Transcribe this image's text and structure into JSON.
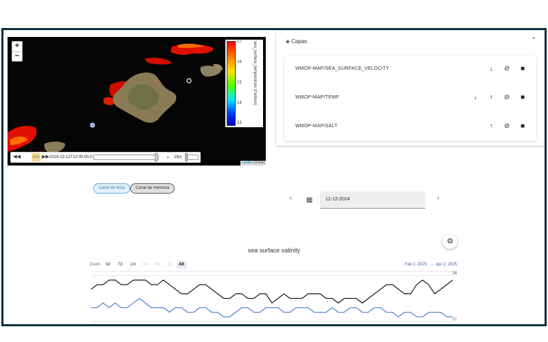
{
  "map": {
    "zoom_in": "+",
    "zoom_out": "−",
    "settings_icon": "gear-icon",
    "legend": {
      "title": "sea_surface_temperature (Celsius)",
      "ticks": [
        "17",
        "16",
        "15",
        "14",
        "13"
      ]
    },
    "timedimension": {
      "back": "◀◀",
      "speed": "0.5x",
      "forward": "▶▶",
      "datetime": "2024-12-12T12:00:00.0",
      "fps": "1fps"
    },
    "attribution": {
      "leaflet": "Leaflet",
      "sep": " | ",
      "esri": "© Esri"
    }
  },
  "layers": {
    "title": "Capas",
    "items": [
      {
        "name": "WMOP-MAP/SEA_SURFACE_VELOCITY",
        "actions": [
          "arrow-down",
          "eye-off",
          "delete"
        ]
      },
      {
        "name": "WMOP-MAP/TEMP",
        "actions": [
          "arrow-down",
          "arrow-up",
          "eye-off",
          "delete"
        ]
      },
      {
        "name": "WMOP-MAP/SALT",
        "actions": [
          "arrow-up",
          "eye-off",
          "delete"
        ]
      }
    ]
  },
  "tabs": [
    {
      "label": "Canal de ibiza",
      "selected": false
    },
    {
      "label": "Canal de menorca",
      "selected": true
    }
  ],
  "date_picker": {
    "value": "12-12-2024",
    "prev": "‹",
    "next": "›"
  },
  "chart": {
    "title": "sea surface salinity",
    "zoom_label": "Zoom",
    "zoom_buttons": [
      {
        "label": "3d",
        "state": "enabled"
      },
      {
        "label": "7d",
        "state": "enabled"
      },
      {
        "label": "1m",
        "state": "enabled"
      },
      {
        "label": "3m",
        "state": "disabled"
      },
      {
        "label": "6m",
        "state": "disabled"
      },
      {
        "label": "1y",
        "state": "disabled"
      },
      {
        "label": "All",
        "state": "selected"
      }
    ],
    "range_from": "Feb 2, 2025",
    "range_arrow": "→",
    "range_to": "Apr 2, 2025",
    "y_ticks": [
      "38",
      "37"
    ]
  },
  "chart_data": {
    "type": "line",
    "title": "sea surface salinity",
    "x_range": [
      "Feb 2, 2025",
      "Apr 2, 2025"
    ],
    "series": [
      {
        "color": "#000000",
        "values": [
          37.7,
          37.8,
          37.8,
          37.9,
          37.9,
          37.8,
          37.8,
          37.9,
          37.9,
          37.9,
          37.8,
          37.8,
          37.9,
          37.8,
          37.7,
          37.6,
          37.6,
          37.7,
          37.8,
          37.8,
          37.7,
          37.6,
          37.5,
          37.5,
          37.6,
          37.6,
          37.5,
          37.5,
          37.6,
          37.6,
          37.4,
          37.5,
          37.6,
          37.5,
          37.5,
          37.5,
          37.6,
          37.6,
          37.6,
          37.5,
          37.5,
          37.4,
          37.5,
          37.5,
          37.5,
          37.4,
          37.5,
          37.6,
          37.7,
          37.8,
          37.8,
          37.7,
          37.6,
          37.6,
          37.8,
          37.9,
          37.8,
          37.6,
          37.7,
          37.8,
          37.9
        ]
      },
      {
        "color": "#3b78c4",
        "values": [
          37.3,
          37.3,
          37.4,
          37.3,
          37.4,
          37.3,
          37.3,
          37.4,
          37.5,
          37.4,
          37.3,
          37.3,
          37.3,
          37.2,
          37.3,
          37.3,
          37.2,
          37.2,
          37.3,
          37.3,
          37.2,
          37.2,
          37.1,
          37.1,
          37.2,
          37.3,
          37.3,
          37.2,
          37.2,
          37.3,
          37.3,
          37.3,
          37.2,
          37.2,
          37.3,
          37.3,
          37.3,
          37.2,
          37.2,
          37.2,
          37.3,
          37.2,
          37.2,
          37.3,
          37.3,
          37.2,
          37.2,
          37.3,
          37.3,
          37.2,
          37.2,
          37.1,
          37.2,
          37.2,
          37.1,
          37.1,
          37.2,
          37.2,
          37.2,
          37.1,
          37.1
        ]
      }
    ],
    "y_ticks": [
      38,
      37
    ],
    "ylim": [
      36.85,
      38.1
    ],
    "grid": true
  }
}
